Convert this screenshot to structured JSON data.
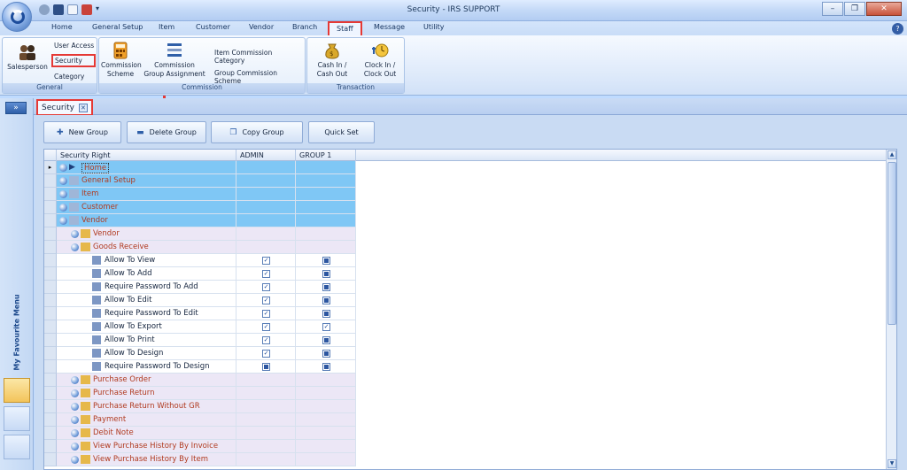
{
  "window": {
    "title": "Security - IRS SUPPORT"
  },
  "ribbon_tabs": [
    "Home",
    "General Setup",
    "Item",
    "Customer",
    "Vendor",
    "Branch",
    "Staff",
    "Message",
    "Utility"
  ],
  "active_tab": "Staff",
  "ribbon": {
    "general": {
      "label": "General",
      "salesperson": "Salesperson",
      "user_access": "User Access",
      "security": "Security",
      "category": "Category"
    },
    "commission": {
      "label": "Commission",
      "commission_scheme": "Commission Scheme",
      "commission_group_assignment": "Commission Group Assignment",
      "item_commission_category": "Item Commission Category",
      "group_commission_scheme": "Group Commission Scheme"
    },
    "transaction": {
      "label": "Transaction",
      "cash_in_out": "Cash In / Cash Out",
      "clock_in_out": "Clock In / Clock Out"
    }
  },
  "sidebar": {
    "favourite_menu": "My Favourite Menu"
  },
  "doc_tab": {
    "label": "Security"
  },
  "toolbar": {
    "new_group": "New Group",
    "delete_group": "Delete Group",
    "copy_group": "Copy Group",
    "quick_set": "Quick Set"
  },
  "grid": {
    "columns": [
      "Security Right",
      "ADMIN",
      "GROUP 1"
    ],
    "rows": [
      {
        "label": "Home",
        "level": 0,
        "selected": true
      },
      {
        "label": "General Setup",
        "level": 0
      },
      {
        "label": "Item",
        "level": 0
      },
      {
        "label": "Customer",
        "level": 0
      },
      {
        "label": "Vendor",
        "level": 0
      },
      {
        "label": "Vendor",
        "level": 1
      },
      {
        "label": "Goods Receive",
        "level": 1
      },
      {
        "label": "Allow To View",
        "level": 2,
        "admin": "checked",
        "group1": "partial"
      },
      {
        "label": "Allow To Add",
        "level": 2,
        "admin": "checked",
        "group1": "partial"
      },
      {
        "label": "Require Password To Add",
        "level": 2,
        "admin": "checked",
        "group1": "partial"
      },
      {
        "label": "Allow To Edit",
        "level": 2,
        "admin": "checked",
        "group1": "partial"
      },
      {
        "label": "Require Password To Edit",
        "level": 2,
        "admin": "checked",
        "group1": "partial"
      },
      {
        "label": "Allow To Export",
        "level": 2,
        "admin": "checked",
        "group1": "checked"
      },
      {
        "label": "Allow To Print",
        "level": 2,
        "admin": "checked",
        "group1": "partial"
      },
      {
        "label": "Allow To Design",
        "level": 2,
        "admin": "checked",
        "group1": "partial"
      },
      {
        "label": "Require Password To Design",
        "level": 2,
        "admin": "partial",
        "group1": "partial"
      },
      {
        "label": "Purchase Order",
        "level": 1
      },
      {
        "label": "Purchase Return",
        "level": 1
      },
      {
        "label": "Purchase Return Without GR",
        "level": 1
      },
      {
        "label": "Payment",
        "level": 1
      },
      {
        "label": "Debit Note",
        "level": 1
      },
      {
        "label": "View Purchase History By Invoice",
        "level": 1
      },
      {
        "label": "View Purchase History By Item",
        "level": 1
      }
    ]
  },
  "colors": {
    "highlight_red": "#e53935",
    "level0_bg": "#7fc7f5",
    "level1_bg": "#ece7f6",
    "label_red": "#b03a1f"
  }
}
